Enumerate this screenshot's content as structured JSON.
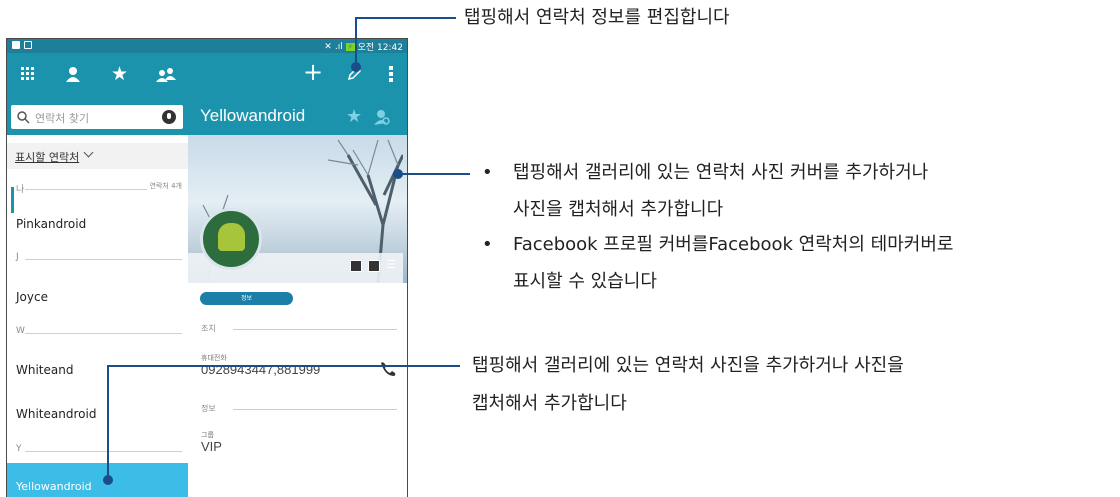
{
  "status_bar": {
    "time": "오전 12:42",
    "signal": ".ıl",
    "battery": "⚡"
  },
  "action_bar": {
    "icons": [
      "apps-grid-icon",
      "person-icon",
      "star-icon",
      "group-icon",
      "add-icon",
      "edit-pencil-icon",
      "overflow-menu-icon"
    ]
  },
  "search": {
    "placeholder": "연락처 찾기"
  },
  "list": {
    "filter_label": "표시할 연락처",
    "sections": [
      {
        "letter": "나",
        "count": "연락처 4개"
      },
      {
        "letter": "J"
      },
      {
        "letter": "W"
      },
      {
        "letter": "Y"
      }
    ],
    "contacts": [
      "Pinkandroid",
      "Joyce",
      "Whiteand",
      "Whiteandroid",
      "Yellowandroid"
    ]
  },
  "detail": {
    "name": "Yellowandroid",
    "tab_label": "정보",
    "actions_header": "조치",
    "phone_label": "휴대전화",
    "phone_value": "0928943447,881999",
    "info_header": "정보",
    "group_label": "그룹",
    "group_value": "VIP"
  },
  "annotations": {
    "edit": "탭핑해서 연락처 정보를 편집합니다",
    "cover_bullet1_line1": "탭핑해서 갤러리에 있는 연락처 사진 커버를 추가하거나",
    "cover_bullet1_line2": "사진을 캡처해서 추가합니다",
    "cover_bullet2_line1": "Facebook 프로필 커버를Facebook 연락처의 테마커버로",
    "cover_bullet2_line2": "표시할 수 있습니다",
    "photo_line1": "탭핑해서 갤러리에 있는 연락처 사진을 추가하거나 사진을",
    "photo_line2": "캡처해서 추가합니다",
    "bullet": "•"
  },
  "colors": {
    "action_bar": "#1b93ad",
    "status_bar": "#1d7f99",
    "selected_row": "#3bbde7",
    "callout_line": "#1a4e8a"
  }
}
